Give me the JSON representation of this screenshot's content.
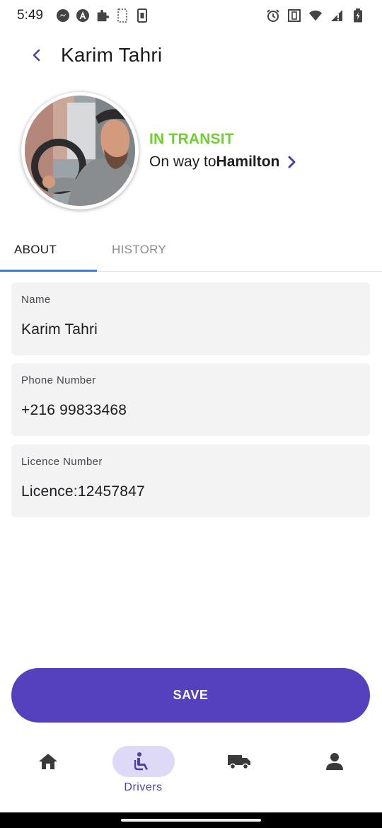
{
  "status_bar": {
    "time": "5:49",
    "left_icons": [
      "messenger-icon",
      "angular-icon",
      "puzzle-icon",
      "screenshot-icon",
      "sim-icon"
    ],
    "right_icons": [
      "alarm-icon",
      "vibrate-icon",
      "wifi-icon",
      "signal-icon",
      "battery-icon"
    ]
  },
  "appbar": {
    "title": "Karim Tahri",
    "back_icon": "chevron-left-icon"
  },
  "profile": {
    "status": "IN TRANSIT",
    "destination_prefix": "On way to",
    "destination": "Hamilton",
    "colors": {
      "status": "#6dd02f"
    }
  },
  "tabs": [
    {
      "label": "ABOUT",
      "active": true
    },
    {
      "label": "HISTORY",
      "active": false
    }
  ],
  "fields": [
    {
      "label": "Name",
      "value": "Karim Tahri"
    },
    {
      "label": "Phone Number",
      "value": "+216 99833468"
    },
    {
      "label": "Licence Number",
      "value": "Licence:12457847"
    }
  ],
  "actions": {
    "save_label": "SAVE",
    "color": "#5541bd"
  },
  "bottom_nav": {
    "items": [
      {
        "icon": "home-icon",
        "label": "",
        "active": false
      },
      {
        "icon": "driver-seat-icon",
        "label": "Drivers",
        "active": true
      },
      {
        "icon": "truck-icon",
        "label": "",
        "active": false
      },
      {
        "icon": "person-icon",
        "label": "",
        "active": false
      }
    ]
  }
}
